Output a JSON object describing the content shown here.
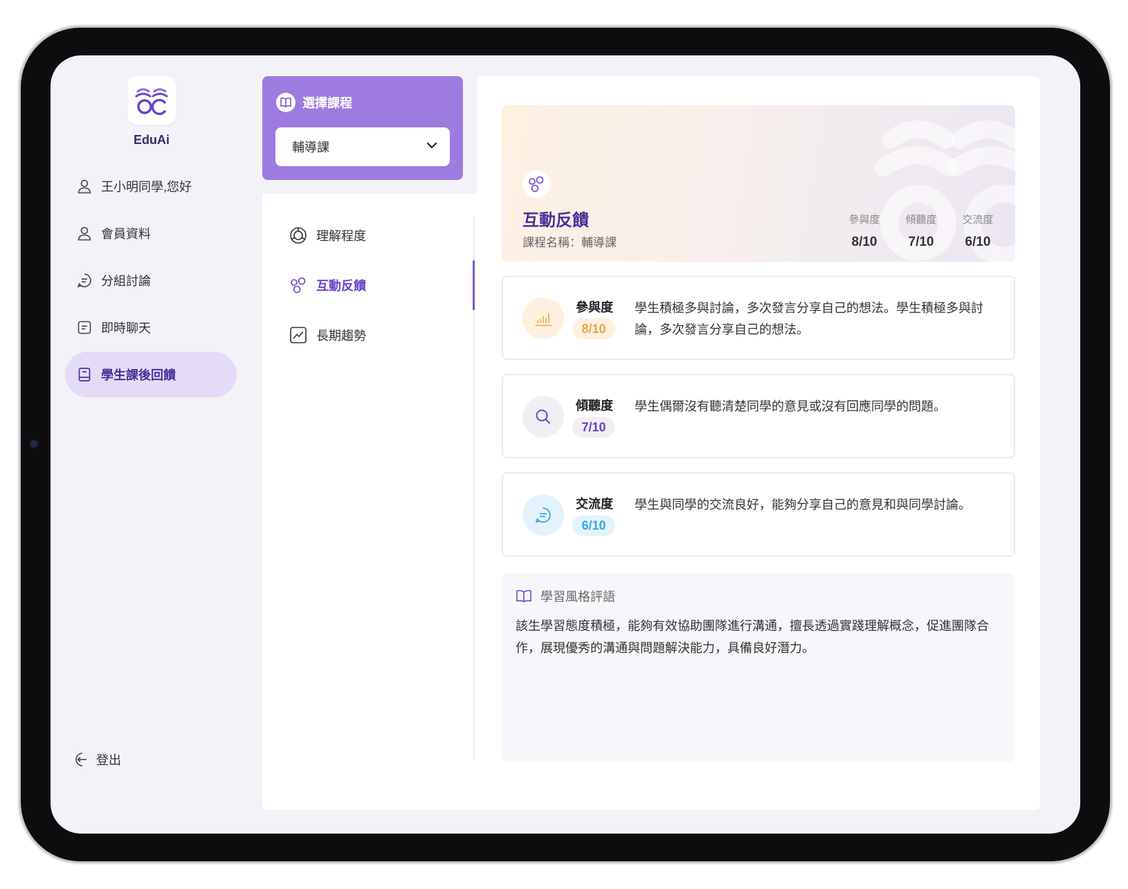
{
  "app": {
    "name": "EduAi"
  },
  "sidebar": {
    "items": [
      {
        "label": "王小明同學,您好",
        "icon": "user-icon"
      },
      {
        "label": "會員資料",
        "icon": "user-icon"
      },
      {
        "label": "分組討論",
        "icon": "chat-bubble-icon"
      },
      {
        "label": "即時聊天",
        "icon": "message-square-icon"
      },
      {
        "label": "學生課後回饋",
        "icon": "book-icon",
        "active": true
      }
    ],
    "logout_label": "登出"
  },
  "course": {
    "label": "選擇課程",
    "selected": "輔導課"
  },
  "submenu": {
    "items": [
      {
        "label": "理解程度",
        "icon": "target-icon"
      },
      {
        "label": "互動反饋",
        "icon": "bubbles-icon",
        "active": true
      },
      {
        "label": "長期趨勢",
        "icon": "trend-chart-icon"
      }
    ]
  },
  "hero": {
    "title": "互動反饋",
    "subtitle": "課程名稱：輔導課",
    "stats": [
      {
        "label": "參與度",
        "value": "8/10"
      },
      {
        "label": "傾聽度",
        "value": "7/10"
      },
      {
        "label": "交流度",
        "value": "6/10"
      }
    ]
  },
  "metrics": [
    {
      "name": "參與度",
      "score": "8/10",
      "description": "學生積極多與討論，多次發言分享自己的想法。學生積極多與討論，多次發言分享自己的想法。",
      "icon": "bar-chart-icon",
      "color": "#e9a94a",
      "bg": "#fdf0df",
      "badge_bg": "#fdf0df"
    },
    {
      "name": "傾聽度",
      "score": "7/10",
      "description": "學生偶爾沒有聽清楚同學的意見或沒有回應同學的問題。",
      "icon": "search-icon",
      "color": "#6a43c9",
      "bg": "#f0eff4",
      "badge_bg": "#f0eff4"
    },
    {
      "name": "交流度",
      "score": "6/10",
      "description": "學生與同學的交流良好，能夠分享自己的意見和與同學討論。",
      "icon": "chat-bubble-icon",
      "color": "#39a7e0",
      "bg": "#e4f3fb",
      "badge_bg": "#e4f3fb"
    }
  ],
  "learning_style": {
    "title": "學習風格評語",
    "text": "該生學習態度積極，能夠有效協助團隊進行溝通，擅長透過實踐理解概念，促進團隊合作，展現優秀的溝通與問題解決能力，具備良好潛力。"
  },
  "colors": {
    "accent": "#9d7be0",
    "accent_dark": "#4a2e9a",
    "active_bg": "#e4dbf6"
  }
}
